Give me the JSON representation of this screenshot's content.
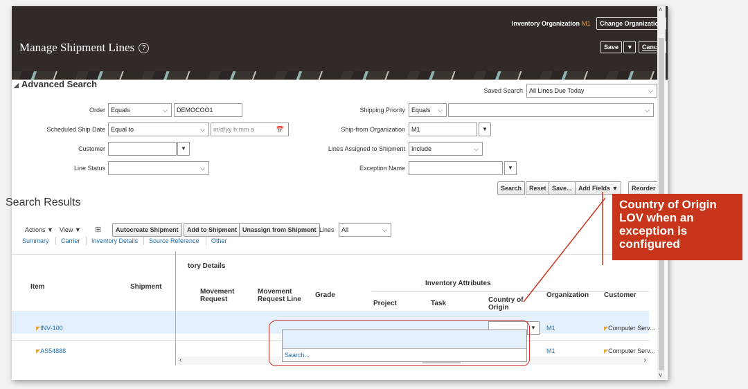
{
  "header": {
    "title": "Manage Shipment Lines",
    "help_icon": "?",
    "inventory_org_label": "Inventory Organization",
    "inventory_org_value": "M1",
    "change_org_label": "Change Organization",
    "save_label": "Save",
    "save_menu_icon": "▼",
    "cancel_label": "Cancel"
  },
  "search": {
    "section_title": "Advanced Search",
    "saved_search_label": "Saved Search",
    "saved_search_value": "All Lines Due Today",
    "order_label": "Order",
    "order_operator": "Equals",
    "order_value": "DEMOCOO1",
    "ship_date_label": "Scheduled Ship Date",
    "ship_date_operator": "Equal to",
    "ship_date_placeholder": "m/d/yy h:mm a",
    "customer_label": "Customer",
    "line_status_label": "Line Status",
    "shipping_priority_label": "Shipping Priority",
    "shipping_priority_operator": "Equals",
    "ship_from_label": "Ship-from Organization",
    "ship_from_value": "M1",
    "lines_assigned_label": "Lines Assigned to Shipment",
    "lines_assigned_value": "Include",
    "exception_name_label": "Exception Name",
    "buttons": {
      "search": "Search",
      "reset": "Reset",
      "save": "Save...",
      "add_fields": "Add Fields",
      "reorder": "Reorder"
    }
  },
  "results": {
    "title": "Search Results",
    "actions": "Actions",
    "view": "View",
    "autocreate": "Autocreate Shipment",
    "add_to_shipment": "Add to Shipment",
    "unassign": "Unassign from Shipment",
    "lines_label": "Lines",
    "lines_value": "All",
    "subtabs": [
      "Summary",
      "Carrier",
      "Inventory Details",
      "Source Reference",
      "Other"
    ],
    "group_header": "tory Details",
    "columns": {
      "item": "Item",
      "shipment": "Shipment",
      "movement_request": "Movement Request",
      "movement_request_line": "Movement Request Line",
      "grade": "Grade",
      "inventory_attributes": "Inventory Attributes",
      "project": "Project",
      "task": "Task",
      "country_of_origin": "Country of Origin",
      "organization": "Organization",
      "customer": "Customer"
    },
    "rows": [
      {
        "item": "INV-100",
        "organization": "M1",
        "customer": "Computer Serv..."
      },
      {
        "item": "AS54888",
        "organization": "M1",
        "customer": "Computer Serv..."
      }
    ],
    "lov_search": "Search..."
  },
  "callout": {
    "text": "Country of Origin LOV when an exception is configured",
    "color": "#c7361a"
  }
}
